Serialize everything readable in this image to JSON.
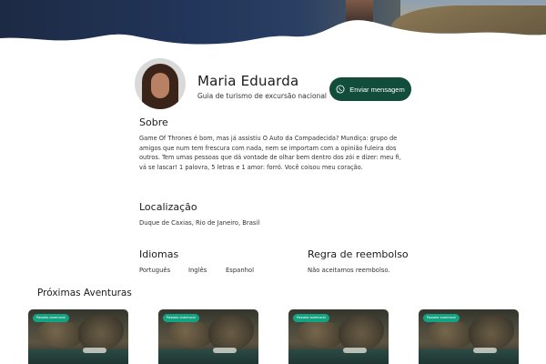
{
  "profile": {
    "name": "Maria Eduarda",
    "role": "Guia de turismo de excursão nacional",
    "message_button": "Enviar mensagem"
  },
  "sobre": {
    "title": "Sobre",
    "text": "Game Of Thrones é bom, mas já assistiu O Auto da Compadecida? Mundiça: grupo de amigos que num tem frescura com nada, nem se importam com a opinião fuleira dos outros. Tem umas pessoas que dá vontade de olhar bem dentro dos zói e dizer: meu fi, vá se lascar! 1 palovra, 5 letras e 1 amor: forró. Você coisou meu coração."
  },
  "localizacao": {
    "title": "Localização",
    "text": "Duque de Caxias, Rio de Janeiro, Brasil"
  },
  "idiomas": {
    "title": "Idiomas",
    "items": [
      "Português",
      "Inglês",
      "Espanhol"
    ]
  },
  "reembolso": {
    "title": "Regra de reembolso",
    "text": "Não aceitamos reembolso."
  },
  "proximas": {
    "title": "Próximas Aventuras",
    "cards": [
      {
        "badge": "Passeio aventural"
      },
      {
        "badge": "Passeio aventural"
      },
      {
        "badge": "Passeio aventural"
      },
      {
        "badge": "Passeio aventural"
      }
    ]
  },
  "colors": {
    "primary": "#124d3c",
    "badge": "#13a383"
  },
  "icons": {
    "message_button_icon": "whatsapp-icon"
  }
}
